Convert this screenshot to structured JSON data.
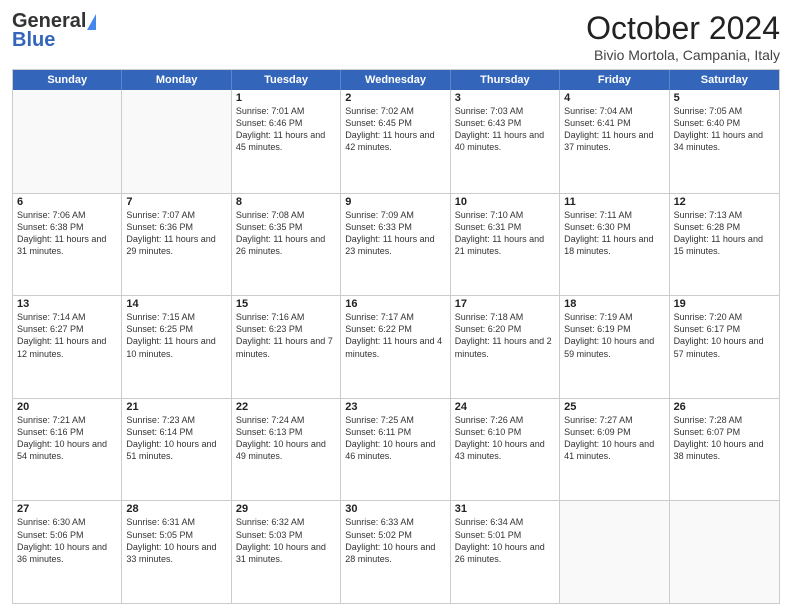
{
  "header": {
    "logo_general": "General",
    "logo_blue": "Blue",
    "title": "October 2024",
    "location": "Bivio Mortola, Campania, Italy"
  },
  "weekdays": [
    "Sunday",
    "Monday",
    "Tuesday",
    "Wednesday",
    "Thursday",
    "Friday",
    "Saturday"
  ],
  "weeks": [
    [
      {
        "day": "",
        "text": ""
      },
      {
        "day": "",
        "text": ""
      },
      {
        "day": "1",
        "text": "Sunrise: 7:01 AM\nSunset: 6:46 PM\nDaylight: 11 hours and 45 minutes."
      },
      {
        "day": "2",
        "text": "Sunrise: 7:02 AM\nSunset: 6:45 PM\nDaylight: 11 hours and 42 minutes."
      },
      {
        "day": "3",
        "text": "Sunrise: 7:03 AM\nSunset: 6:43 PM\nDaylight: 11 hours and 40 minutes."
      },
      {
        "day": "4",
        "text": "Sunrise: 7:04 AM\nSunset: 6:41 PM\nDaylight: 11 hours and 37 minutes."
      },
      {
        "day": "5",
        "text": "Sunrise: 7:05 AM\nSunset: 6:40 PM\nDaylight: 11 hours and 34 minutes."
      }
    ],
    [
      {
        "day": "6",
        "text": "Sunrise: 7:06 AM\nSunset: 6:38 PM\nDaylight: 11 hours and 31 minutes."
      },
      {
        "day": "7",
        "text": "Sunrise: 7:07 AM\nSunset: 6:36 PM\nDaylight: 11 hours and 29 minutes."
      },
      {
        "day": "8",
        "text": "Sunrise: 7:08 AM\nSunset: 6:35 PM\nDaylight: 11 hours and 26 minutes."
      },
      {
        "day": "9",
        "text": "Sunrise: 7:09 AM\nSunset: 6:33 PM\nDaylight: 11 hours and 23 minutes."
      },
      {
        "day": "10",
        "text": "Sunrise: 7:10 AM\nSunset: 6:31 PM\nDaylight: 11 hours and 21 minutes."
      },
      {
        "day": "11",
        "text": "Sunrise: 7:11 AM\nSunset: 6:30 PM\nDaylight: 11 hours and 18 minutes."
      },
      {
        "day": "12",
        "text": "Sunrise: 7:13 AM\nSunset: 6:28 PM\nDaylight: 11 hours and 15 minutes."
      }
    ],
    [
      {
        "day": "13",
        "text": "Sunrise: 7:14 AM\nSunset: 6:27 PM\nDaylight: 11 hours and 12 minutes."
      },
      {
        "day": "14",
        "text": "Sunrise: 7:15 AM\nSunset: 6:25 PM\nDaylight: 11 hours and 10 minutes."
      },
      {
        "day": "15",
        "text": "Sunrise: 7:16 AM\nSunset: 6:23 PM\nDaylight: 11 hours and 7 minutes."
      },
      {
        "day": "16",
        "text": "Sunrise: 7:17 AM\nSunset: 6:22 PM\nDaylight: 11 hours and 4 minutes."
      },
      {
        "day": "17",
        "text": "Sunrise: 7:18 AM\nSunset: 6:20 PM\nDaylight: 11 hours and 2 minutes."
      },
      {
        "day": "18",
        "text": "Sunrise: 7:19 AM\nSunset: 6:19 PM\nDaylight: 10 hours and 59 minutes."
      },
      {
        "day": "19",
        "text": "Sunrise: 7:20 AM\nSunset: 6:17 PM\nDaylight: 10 hours and 57 minutes."
      }
    ],
    [
      {
        "day": "20",
        "text": "Sunrise: 7:21 AM\nSunset: 6:16 PM\nDaylight: 10 hours and 54 minutes."
      },
      {
        "day": "21",
        "text": "Sunrise: 7:23 AM\nSunset: 6:14 PM\nDaylight: 10 hours and 51 minutes."
      },
      {
        "day": "22",
        "text": "Sunrise: 7:24 AM\nSunset: 6:13 PM\nDaylight: 10 hours and 49 minutes."
      },
      {
        "day": "23",
        "text": "Sunrise: 7:25 AM\nSunset: 6:11 PM\nDaylight: 10 hours and 46 minutes."
      },
      {
        "day": "24",
        "text": "Sunrise: 7:26 AM\nSunset: 6:10 PM\nDaylight: 10 hours and 43 minutes."
      },
      {
        "day": "25",
        "text": "Sunrise: 7:27 AM\nSunset: 6:09 PM\nDaylight: 10 hours and 41 minutes."
      },
      {
        "day": "26",
        "text": "Sunrise: 7:28 AM\nSunset: 6:07 PM\nDaylight: 10 hours and 38 minutes."
      }
    ],
    [
      {
        "day": "27",
        "text": "Sunrise: 6:30 AM\nSunset: 5:06 PM\nDaylight: 10 hours and 36 minutes."
      },
      {
        "day": "28",
        "text": "Sunrise: 6:31 AM\nSunset: 5:05 PM\nDaylight: 10 hours and 33 minutes."
      },
      {
        "day": "29",
        "text": "Sunrise: 6:32 AM\nSunset: 5:03 PM\nDaylight: 10 hours and 31 minutes."
      },
      {
        "day": "30",
        "text": "Sunrise: 6:33 AM\nSunset: 5:02 PM\nDaylight: 10 hours and 28 minutes."
      },
      {
        "day": "31",
        "text": "Sunrise: 6:34 AM\nSunset: 5:01 PM\nDaylight: 10 hours and 26 minutes."
      },
      {
        "day": "",
        "text": ""
      },
      {
        "day": "",
        "text": ""
      }
    ]
  ]
}
